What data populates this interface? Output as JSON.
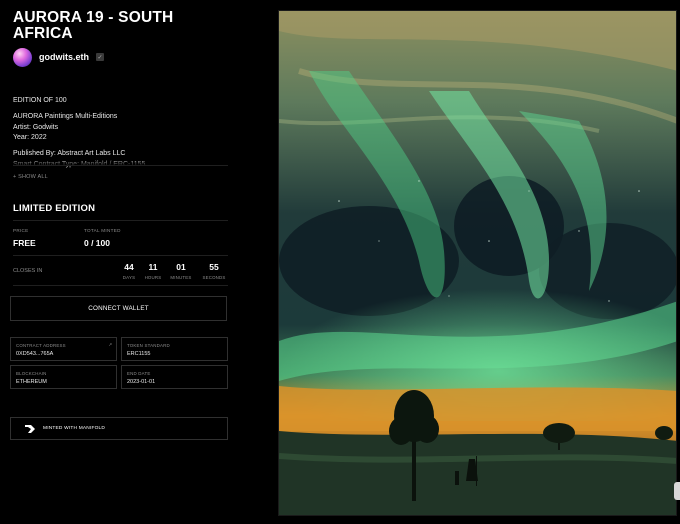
{
  "title": "AURORA 19 - SOUTH AFRICA",
  "creator": {
    "name": "godwits.eth"
  },
  "description": {
    "edition": "EDITION OF 100",
    "collection": "AURORA Paintings Multi-Editions",
    "artist": "Artist: Godwits",
    "year": "Year: 2022",
    "publisher": "Published By: Abstract Art Labs LLC",
    "contract_faded": "Smart Contract Type: Manifold / ERC-1155"
  },
  "show_all_label": "+ SHOW ALL",
  "sale": {
    "section_title": "LIMITED EDITION",
    "price_label": "PRICE",
    "price_value": "FREE",
    "minted_label": "TOTAL MINTED",
    "minted_value": "0 / 100",
    "closes_label": "CLOSES IN",
    "countdown": [
      {
        "value": "44",
        "unit": "DAYS"
      },
      {
        "value": "11",
        "unit": "HOURS"
      },
      {
        "value": "01",
        "unit": "MINUTES"
      },
      {
        "value": "55",
        "unit": "SECONDS"
      }
    ],
    "connect_label": "CONNECT WALLET"
  },
  "details": {
    "contract_label": "CONTRACT ADDRESS",
    "contract_value": "0XD543...765A",
    "contract_ext": "↗",
    "token_label": "TOKEN STANDARD",
    "token_value": "ERC1155",
    "chain_label": "BLOCKCHAIN",
    "chain_value": "ETHEREUM",
    "end_label": "END DATE",
    "end_value": "2023-01-01"
  },
  "manifold_label": "MINTED WITH MANIFOLD",
  "colors": {
    "background": "#000000",
    "border": "#303030",
    "muted_text": "#8c8c8c",
    "aurora_green": "#4fd48a",
    "sky_teal": "#2f6a5a",
    "horizon_orange": "#e39a2c"
  }
}
